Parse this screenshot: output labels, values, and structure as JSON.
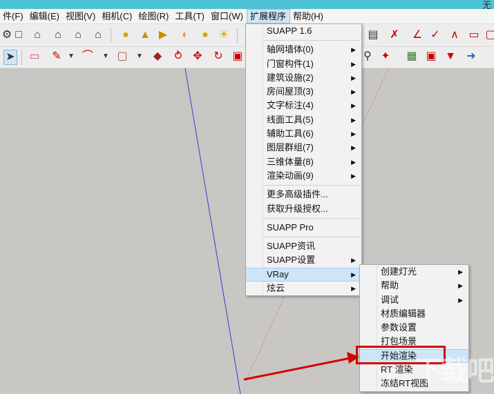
{
  "window": {
    "title_fragment": "无"
  },
  "menubar": {
    "items": [
      {
        "label": "件(F)",
        "active": false
      },
      {
        "label": "编辑(E)",
        "active": false
      },
      {
        "label": "视图(V)",
        "active": false
      },
      {
        "label": "相机(C)",
        "active": false
      },
      {
        "label": "绘图(R)",
        "active": false
      },
      {
        "label": "工具(T)",
        "active": false
      },
      {
        "label": "窗口(W)",
        "active": false
      },
      {
        "label": "扩展程序",
        "active": true
      },
      {
        "label": "帮助(H)",
        "active": false
      }
    ]
  },
  "extensions_menu": {
    "header": "SUAPP 1.6",
    "groups": [
      [
        {
          "label": "轴网墙体(0)",
          "submenu": true
        },
        {
          "label": "门窗构件(1)",
          "submenu": true
        },
        {
          "label": "建筑设施(2)",
          "submenu": true
        },
        {
          "label": "房间屋顶(3)",
          "submenu": true
        },
        {
          "label": "文字标注(4)",
          "submenu": true
        },
        {
          "label": "线面工具(5)",
          "submenu": true
        },
        {
          "label": "辅助工具(6)",
          "submenu": true
        },
        {
          "label": "图层群组(7)",
          "submenu": true
        },
        {
          "label": "三维体量(8)",
          "submenu": true
        },
        {
          "label": "渲染动画(9)",
          "submenu": true
        }
      ],
      [
        {
          "label": "更多高级插件...",
          "submenu": false
        },
        {
          "label": "获取升级授权...",
          "submenu": false
        }
      ],
      [
        {
          "label": "SUAPP Pro",
          "submenu": false
        }
      ],
      [
        {
          "label": "SUAPP资讯",
          "submenu": false
        },
        {
          "label": "SUAPP设置",
          "submenu": true
        },
        {
          "label": "VRay",
          "submenu": true,
          "highlighted": true
        },
        {
          "label": "炫云",
          "submenu": true
        }
      ]
    ]
  },
  "vray_menu": {
    "items": [
      {
        "label": "创建灯光",
        "submenu": true
      },
      {
        "label": "帮助",
        "submenu": true
      },
      {
        "label": "调试",
        "submenu": true
      },
      {
        "label": "材质编辑器",
        "submenu": false
      },
      {
        "label": "参数设置",
        "submenu": false
      },
      {
        "label": "打包场景",
        "submenu": false
      },
      {
        "label": "开始渲染",
        "submenu": false,
        "highlighted": true
      },
      {
        "label": "RT 渲染",
        "submenu": false
      },
      {
        "label": "冻结RT视图",
        "submenu": false
      }
    ]
  },
  "colors": {
    "annotation_red": "#d40000",
    "menu_highlight": "#cde5f7",
    "axis_blue": "#3a3ad0",
    "axis_red_dotted": "#c04040"
  },
  "watermark": {
    "text": "下载吧"
  }
}
